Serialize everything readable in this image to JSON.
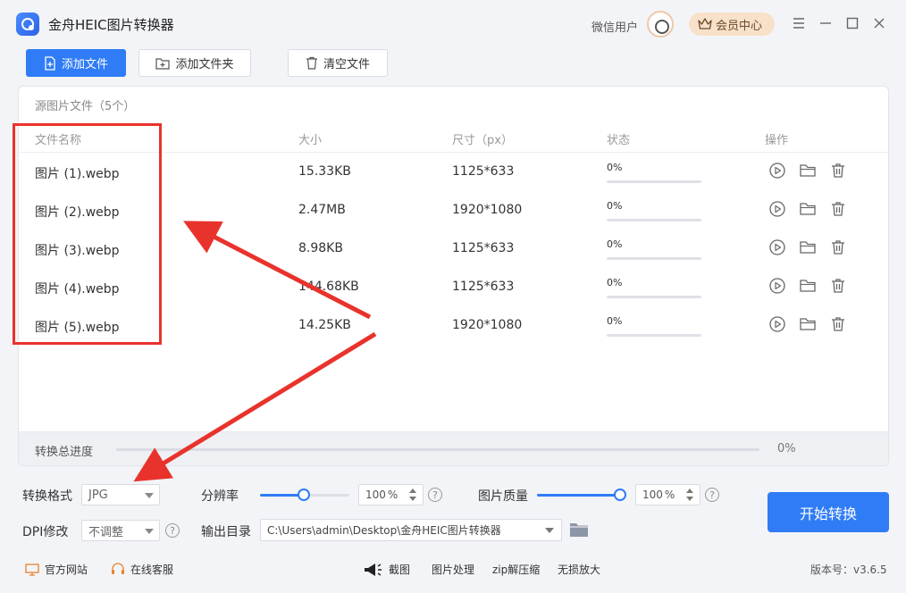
{
  "app": {
    "title": "金舟HEIC图片转换器",
    "user_name": "微信用户",
    "vip_label": "会员中心"
  },
  "toolbar": {
    "add_file": "添加文件",
    "add_folder": "添加文件夹",
    "clear_files": "清空文件"
  },
  "file_panel": {
    "title": "源图片文件（5个）",
    "columns": {
      "name": "文件名称",
      "size": "大小",
      "dimensions": "尺寸（px）",
      "status": "状态",
      "actions": "操作"
    },
    "rows": [
      {
        "name": "图片 (1).webp",
        "size": "15.33KB",
        "dimensions": "1125*633",
        "status": "0%",
        "progress": 0
      },
      {
        "name": "图片 (2).webp",
        "size": "2.47MB",
        "dimensions": "1920*1080",
        "status": "0%",
        "progress": 0
      },
      {
        "name": "图片 (3).webp",
        "size": "8.98KB",
        "dimensions": "1125*633",
        "status": "0%",
        "progress": 0
      },
      {
        "name": "图片 (4).webp",
        "size": "144.68KB",
        "dimensions": "1125*633",
        "status": "0%",
        "progress": 0
      },
      {
        "name": "图片 (5).webp",
        "size": "14.25KB",
        "dimensions": "1920*1080",
        "status": "0%",
        "progress": 0
      }
    ],
    "total_label": "转换总进度",
    "total_pct": "0%"
  },
  "settings": {
    "format_label": "转换格式",
    "format_value": "JPG",
    "resolution_label": "分辨率",
    "resolution_value": "100",
    "quality_label": "图片质量",
    "quality_value": "100",
    "percent_sign": "%",
    "dpi_label": "DPI修改",
    "dpi_value": "不调整",
    "output_label": "输出目录",
    "output_path": "C:\\Users\\admin\\Desktop\\金舟HEIC图片转换器",
    "help_glyph": "?",
    "start_label": "开始转换"
  },
  "footer": {
    "website": "官方网站",
    "support": "在线客服",
    "screenshot": "截图",
    "image_process": "图片处理",
    "zip": "zip解压缩",
    "upscale": "无损放大",
    "version": "版本号：v3.6.5"
  },
  "colors": {
    "accent": "#2f7cf6",
    "annotation": "#e8332c",
    "vip_bg": "#f7e1c8"
  }
}
